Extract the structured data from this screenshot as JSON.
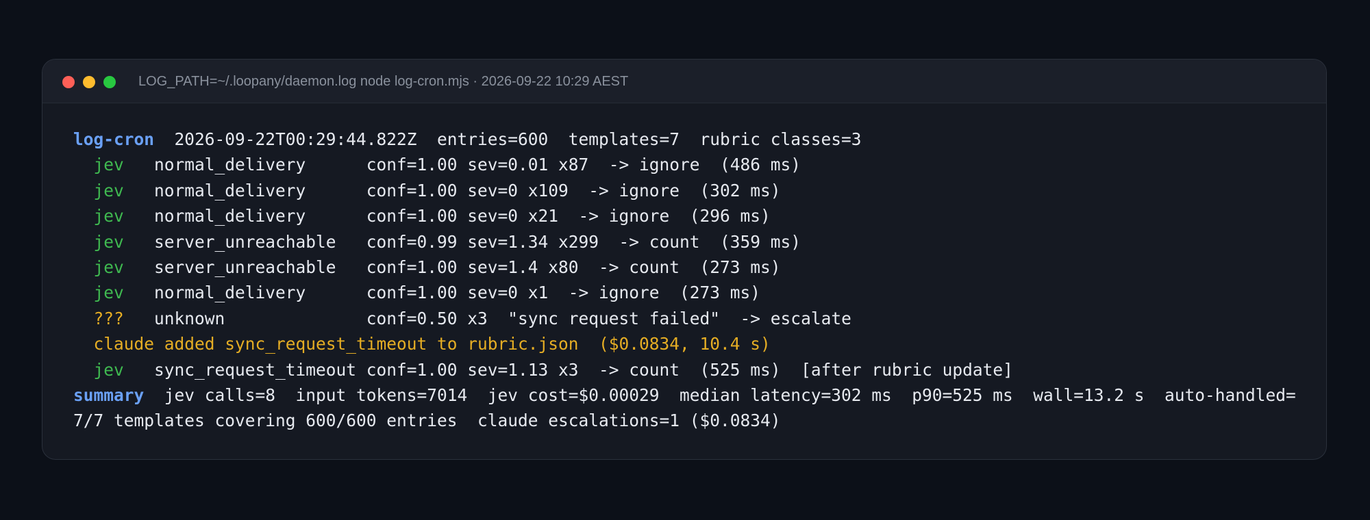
{
  "window": {
    "title": "LOG_PATH=~/.loopany/daemon.log node log-cron.mjs · 2026-09-22 10:29 AEST"
  },
  "terminal": {
    "header": {
      "prompt": "log-cron",
      "text": "  2026-09-22T00:29:44.822Z  entries=600  templates=7  rubric classes=3"
    },
    "rows": [
      {
        "indent": "  ",
        "tag": "jev",
        "sep": "   ",
        "text": "normal_delivery      conf=1.00 sev=0.01 x87  -> ignore  (486 ms)",
        "tag_color": "green"
      },
      {
        "indent": "  ",
        "tag": "jev",
        "sep": "   ",
        "text": "normal_delivery      conf=1.00 sev=0 x109  -> ignore  (302 ms)",
        "tag_color": "green"
      },
      {
        "indent": "  ",
        "tag": "jev",
        "sep": "   ",
        "text": "normal_delivery      conf=1.00 sev=0 x21  -> ignore  (296 ms)",
        "tag_color": "green"
      },
      {
        "indent": "  ",
        "tag": "jev",
        "sep": "   ",
        "text": "server_unreachable   conf=0.99 sev=1.34 x299  -> count  (359 ms)",
        "tag_color": "green"
      },
      {
        "indent": "  ",
        "tag": "jev",
        "sep": "   ",
        "text": "server_unreachable   conf=1.00 sev=1.4 x80  -> count  (273 ms)",
        "tag_color": "green"
      },
      {
        "indent": "  ",
        "tag": "jev",
        "sep": "   ",
        "text": "normal_delivery      conf=1.00 sev=0 x1  -> ignore  (273 ms)",
        "tag_color": "green"
      },
      {
        "indent": "  ",
        "tag": "???",
        "sep": "   ",
        "text": "unknown              conf=0.50 x3  \"sync request failed\"  -> escalate",
        "tag_color": "yellow"
      }
    ],
    "notice": "  claude added sync_request_timeout to rubric.json  ($0.0834, 10.4 s)",
    "final_row": {
      "indent": "  ",
      "tag": "jev",
      "sep": "   ",
      "text": "sync_request_timeout conf=1.00 sev=1.13 x3  -> count  (525 ms)  [after rubric update]",
      "tag_color": "green"
    },
    "summary": {
      "label": "summary",
      "text": "  jev calls=8  input tokens=7014  jev cost=$0.00029  median latency=302 ms  p90=525 ms  wall=13.2 s  auto-handled=7/7 templates covering 600/600 entries  claude escalations=1 ($0.0834)"
    }
  },
  "colors": {
    "background": "#0c1018",
    "window": "#151922",
    "titlebar": "#1b1f29",
    "text": "#e6e9ef",
    "accent_blue": "#6aa0f5",
    "ok_green": "#3fb950",
    "warn_yellow": "#e5ad24",
    "close_red": "#fe5f57",
    "minimize_yellow": "#febc2e",
    "zoom_green": "#28c840"
  }
}
